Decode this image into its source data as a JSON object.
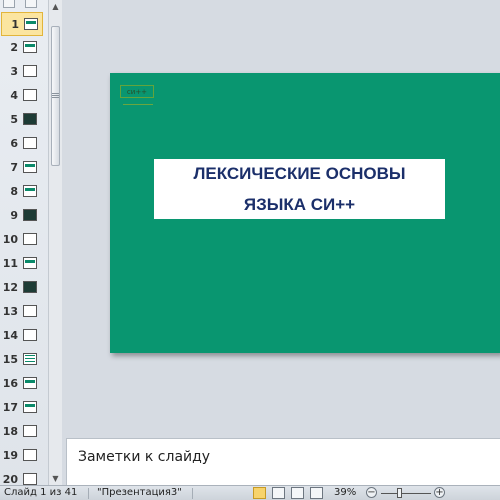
{
  "thumbnail_pane": {
    "tabs": [
      "slides-tab",
      "outline-tab"
    ],
    "items": [
      {
        "number": "1",
        "selected": true
      },
      {
        "number": "2"
      },
      {
        "number": "3"
      },
      {
        "number": "4"
      },
      {
        "number": "5"
      },
      {
        "number": "6"
      },
      {
        "number": "7"
      },
      {
        "number": "8"
      },
      {
        "number": "9"
      },
      {
        "number": "10"
      },
      {
        "number": "11"
      },
      {
        "number": "12"
      },
      {
        "number": "13"
      },
      {
        "number": "14"
      },
      {
        "number": "15"
      },
      {
        "number": "16"
      },
      {
        "number": "17"
      },
      {
        "number": "18"
      },
      {
        "number": "19"
      },
      {
        "number": "20"
      }
    ]
  },
  "slide": {
    "background_color": "#099670",
    "tag_text": "си++",
    "title_line1": "ЛЕКСИЧЕСКИЕ ОСНОВЫ",
    "title_line2": "ЯЗЫКА СИ++",
    "title_color": "#1b2f6a"
  },
  "notes": {
    "placeholder": "Заметки к слайду"
  },
  "status_bar": {
    "slide_info": "Слайд 1 из 41",
    "theme_name": "\"Презентация3\"",
    "zoom": "39%",
    "zoom_out": "−",
    "zoom_in": "+"
  }
}
